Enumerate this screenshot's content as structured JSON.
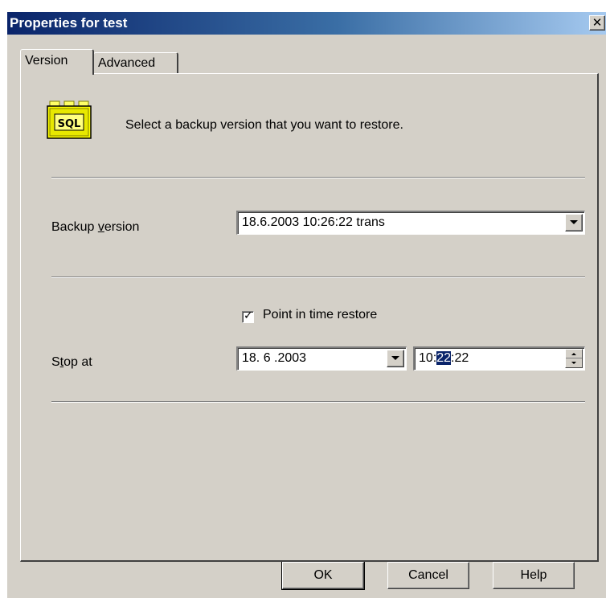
{
  "window": {
    "title": "Properties for test",
    "close_glyph": "✕"
  },
  "tabs": [
    {
      "label": "Version",
      "active": true
    },
    {
      "label": "Advanced",
      "active": false
    }
  ],
  "version_tab": {
    "icon": "sql-server-icon",
    "icon_text": "SQL",
    "intro_text": "Select a backup version that you want to restore.",
    "backup_version": {
      "label_pre": "Backup ",
      "label_accel": "v",
      "label_post": "ersion",
      "value": "18.6.2003 10:26:22 trans"
    },
    "point_in_time": {
      "label": "Point in time restore",
      "checked": true,
      "check_glyph": "✓"
    },
    "stop_at": {
      "label_pre": "S",
      "label_accel": "t",
      "label_post": "op at",
      "date_value": "18. 6 .2003",
      "time_hours": "10:",
      "time_minutes_selected": "22",
      "time_seconds": ":22"
    }
  },
  "buttons": {
    "ok": "OK",
    "cancel": "Cancel",
    "help": "Help"
  },
  "colors": {
    "title_start": "#0a246a",
    "title_end": "#a6caf0",
    "face": "#d4d0c8",
    "selection": "#0a246a"
  }
}
